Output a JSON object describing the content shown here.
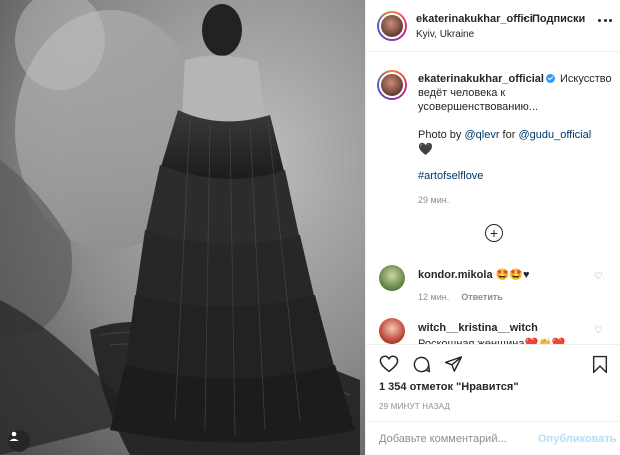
{
  "post": {
    "username": "ekaterinakukhar_offici",
    "follow_dot": "•",
    "follow_label": "Подписки",
    "location": "Kyiv, Ukraine"
  },
  "caption": {
    "username": "ekaterinakukhar_official",
    "text": "Искусство ведёт человека к усовершенствованию...",
    "photo_by": "Photo by ",
    "photographer": "@qlevr",
    "for_word": " for ",
    "brand": "@gudu_official",
    "heart": "🖤",
    "hashtag": "#artofselflove",
    "time": "29 мин."
  },
  "comments": [
    {
      "username": "kondor.mikola",
      "text": " 🤩🤩♥",
      "time": "12 мин.",
      "reply_label": "Ответить"
    },
    {
      "username": "witch__kristina__witch",
      "text": "Роскошная женщина❤️👏❤️"
    }
  ],
  "stats": {
    "likes": "1 354 отметок \"Нравится\"",
    "posted": "29 МИНУТ НАЗАД"
  },
  "comment_box": {
    "placeholder": "Добавьте комментарий...",
    "publish_label": "Опубликовать"
  },
  "colors": {
    "link": "#00376b",
    "muted": "#8e8e8e",
    "publish_disabled": "#b2dffc",
    "verified": "#3897f0"
  }
}
